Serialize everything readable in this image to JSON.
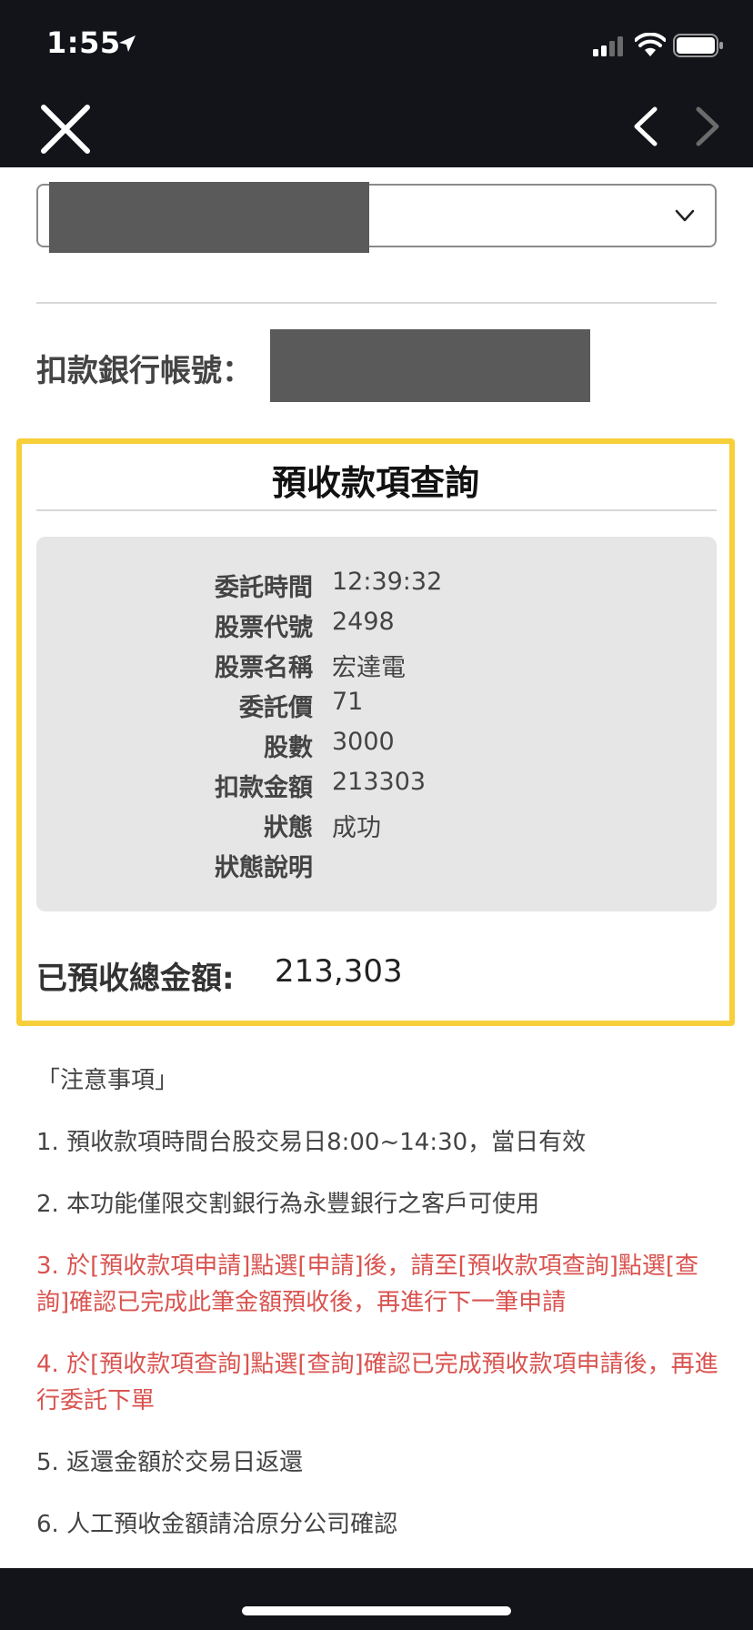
{
  "status_bar": {
    "time": "1:55"
  },
  "icons": {
    "location": "location-arrow-icon",
    "signal": "cellular-signal-icon",
    "wifi": "wifi-icon",
    "battery": "battery-icon",
    "close": "close-icon",
    "back": "chevron-left-icon",
    "forward": "chevron-right-icon",
    "select": "chevron-down-icon"
  },
  "account": {
    "bank_label": "扣款銀行帳號："
  },
  "query": {
    "title": "預收款項查詢",
    "rows": [
      {
        "label": "委託時間",
        "value": "12:39:32"
      },
      {
        "label": "股票代號",
        "value": "2498"
      },
      {
        "label": "股票名稱",
        "value": "宏達電"
      },
      {
        "label": "委託價",
        "value": "71"
      },
      {
        "label": "股數",
        "value": "3000"
      },
      {
        "label": "扣款金額",
        "value": "213303"
      },
      {
        "label": "狀態",
        "value": "成功"
      },
      {
        "label": "狀態說明",
        "value": ""
      }
    ],
    "total_label": "已預收總金額:",
    "total_value": "213,303"
  },
  "notes": {
    "header": "「注意事項」",
    "items": [
      "1. 預收款項時間台股交易日8:00~14:30，當日有效",
      "2. 本功能僅限交割銀行為永豐銀行之客戶可使用",
      "3. 於[預收款項申請]點選[申請]後，請至[預收款項查詢]點選[查詢]確認已完成此筆金額預收後，再進行下一筆申請",
      "4. 於[預收款項查詢]點選[查詢]確認已完成預收款項申請後，再進行委託下單",
      "5. 返還金額於交易日返還",
      "6. 人工預收金額請洽原分公司確認"
    ]
  },
  "colors": {
    "dark_bar": "#12141a",
    "highlight_border": "#f7cf3a",
    "warning_text": "#d9534f",
    "panel_bg": "#e6e6e6"
  }
}
